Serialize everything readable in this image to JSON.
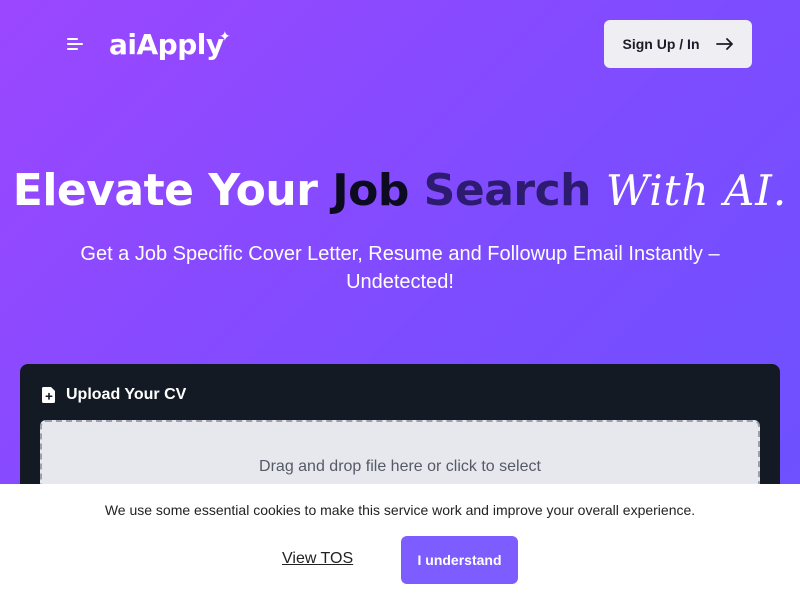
{
  "header": {
    "logo_text": "aiApply",
    "logo_spark": "✦",
    "signup_label": "Sign Up / In",
    "icons": {
      "menu": "hamburger-menu-icon",
      "arrow": "arrow-right-icon"
    }
  },
  "hero": {
    "title_part1": "Elevate Your ",
    "title_job": "Job",
    "title_search": "Search",
    "title_script": "With AI.",
    "subtitle": "Get a Job Specific Cover Letter, Resume and Followup Email Instantly – Undetected!"
  },
  "upload": {
    "title": "Upload Your CV",
    "dropzone_text": "Drag and drop file here or click to select",
    "icon": "file-plus-icon"
  },
  "cookie": {
    "text": "We use some essential cookies to make this service work and improve your overall experience.",
    "tos_label": "View TOS",
    "accept_label": "I understand"
  },
  "colors": {
    "gradient_start": "#9b47ff",
    "gradient_end": "#6a52ff",
    "accent_button": "#7d5dff",
    "card_bg": "#141a24"
  }
}
